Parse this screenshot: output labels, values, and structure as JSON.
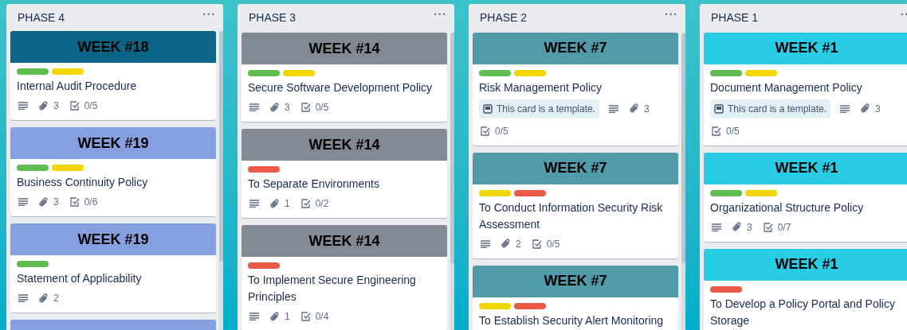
{
  "lists": [
    {
      "title": "PHASE 4",
      "menu": "···",
      "cards": [
        {
          "cover": {
            "text": "WEEK #18",
            "color": "#0b6587"
          },
          "labels": [
            {
              "color": "#61bd4f"
            },
            {
              "color": "#f2d600"
            }
          ],
          "title": "Internal Audit Procedure",
          "badges": [
            {
              "kind": "description"
            },
            {
              "kind": "attachments",
              "text": "3"
            },
            {
              "kind": "checklist",
              "text": "0/5"
            }
          ]
        },
        {
          "cover": {
            "text": "WEEK #19",
            "color": "#869fdf"
          },
          "labels": [
            {
              "color": "#61bd4f"
            },
            {
              "color": "#f2d600"
            }
          ],
          "title": "Business Continuity Policy",
          "badges": [
            {
              "kind": "description"
            },
            {
              "kind": "attachments",
              "text": "3"
            },
            {
              "kind": "checklist",
              "text": "0/6"
            }
          ]
        },
        {
          "cover": {
            "text": "WEEK #19",
            "color": "#869fdf"
          },
          "labels": [
            {
              "color": "#61bd4f"
            }
          ],
          "title": "Statement of Applicability",
          "badges": [
            {
              "kind": "description"
            },
            {
              "kind": "attachments",
              "text": "2"
            }
          ]
        },
        {
          "cover": {
            "color": "#869fdf"
          }
        }
      ]
    },
    {
      "title": "PHASE 3",
      "menu": "···",
      "cards": [
        {
          "cover": {
            "text": "WEEK #14",
            "color": "#838993"
          },
          "labels": [
            {
              "color": "#61bd4f"
            },
            {
              "color": "#f2d600"
            }
          ],
          "title": "Secure Software Development Policy",
          "badges": [
            {
              "kind": "description"
            },
            {
              "kind": "attachments",
              "text": "3"
            },
            {
              "kind": "checklist",
              "text": "0/5"
            }
          ]
        },
        {
          "cover": {
            "text": "WEEK #14",
            "color": "#838993"
          },
          "labels": [
            {
              "color": "#eb5a46"
            }
          ],
          "title": "To Separate Environments",
          "badges": [
            {
              "kind": "description"
            },
            {
              "kind": "attachments",
              "text": "1"
            },
            {
              "kind": "checklist",
              "text": "0/2"
            }
          ]
        },
        {
          "cover": {
            "text": "WEEK #14",
            "color": "#838993"
          },
          "labels": [
            {
              "color": "#eb5a46"
            }
          ],
          "title": "To Implement Secure Engineering Principles",
          "badges": [
            {
              "kind": "description"
            },
            {
              "kind": "attachments",
              "text": "1"
            },
            {
              "kind": "checklist",
              "text": "0/4"
            }
          ]
        }
      ]
    },
    {
      "title": "PHASE 2",
      "menu": "···",
      "cards": [
        {
          "cover": {
            "text": "WEEK #7",
            "color": "#519aa9"
          },
          "labels": [
            {
              "color": "#61bd4f"
            },
            {
              "color": "#f2d600"
            }
          ],
          "title": "Risk Management Policy",
          "badges": [
            {
              "kind": "template",
              "text": "This card is a template."
            },
            {
              "kind": "description"
            },
            {
              "kind": "attachments",
              "text": "3"
            },
            {
              "kind": "checklist",
              "text": "0/5"
            }
          ]
        },
        {
          "cover": {
            "text": "WEEK #7",
            "color": "#519aa9"
          },
          "labels": [
            {
              "color": "#f2d600"
            },
            {
              "color": "#eb5a46"
            }
          ],
          "title": "To Conduct Information Security Risk Assessment",
          "badges": [
            {
              "kind": "description"
            },
            {
              "kind": "attachments",
              "text": "2"
            },
            {
              "kind": "checklist",
              "text": "0/5"
            }
          ]
        },
        {
          "cover": {
            "text": "WEEK #7",
            "color": "#519aa9"
          },
          "labels": [
            {
              "color": "#f2d600"
            },
            {
              "color": "#eb5a46"
            }
          ],
          "title": "To Establish Security Alert Monitoring"
        }
      ]
    },
    {
      "title": "PHASE 1",
      "menu": "··",
      "cards": [
        {
          "cover": {
            "text": "WEEK #1",
            "color": "#29cce5"
          },
          "labels": [
            {
              "color": "#61bd4f"
            },
            {
              "color": "#f2d600"
            }
          ],
          "title": "Document Management Policy",
          "badges": [
            {
              "kind": "template",
              "text": "This card is a template."
            },
            {
              "kind": "description"
            },
            {
              "kind": "attachments",
              "text": "3"
            },
            {
              "kind": "checklist",
              "text": "0/5"
            }
          ]
        },
        {
          "cover": {
            "text": "WEEK #1",
            "color": "#29cce5"
          },
          "labels": [
            {
              "color": "#61bd4f"
            },
            {
              "color": "#f2d600"
            }
          ],
          "title": "Organizational Structure Policy",
          "badges": [
            {
              "kind": "description"
            },
            {
              "kind": "attachments",
              "text": "3"
            },
            {
              "kind": "checklist",
              "text": "0/7"
            }
          ]
        },
        {
          "cover": {
            "text": "WEEK #1",
            "color": "#29cce5"
          },
          "labels": [
            {
              "color": "#eb5a46"
            }
          ],
          "title": "To Develop a Policy Portal and Policy Storage"
        }
      ]
    }
  ]
}
